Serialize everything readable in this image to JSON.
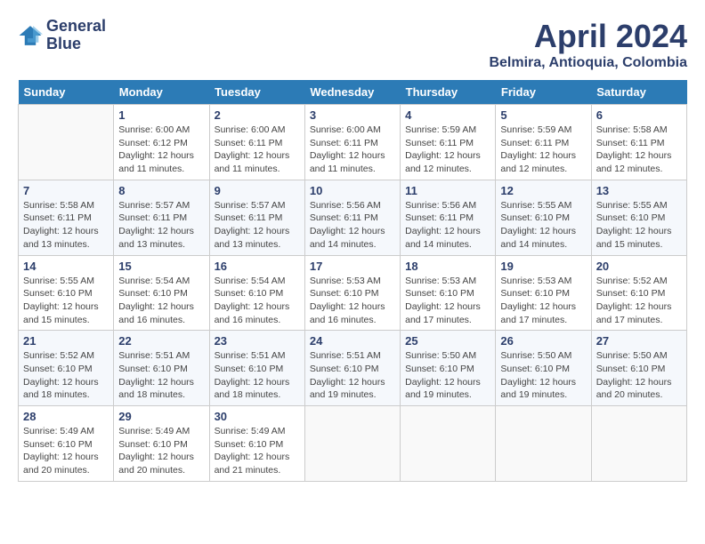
{
  "header": {
    "logo_line1": "General",
    "logo_line2": "Blue",
    "month": "April 2024",
    "location": "Belmira, Antioquia, Colombia"
  },
  "weekdays": [
    "Sunday",
    "Monday",
    "Tuesday",
    "Wednesday",
    "Thursday",
    "Friday",
    "Saturday"
  ],
  "weeks": [
    [
      {
        "day": "",
        "info": ""
      },
      {
        "day": "1",
        "info": "Sunrise: 6:00 AM\nSunset: 6:12 PM\nDaylight: 12 hours\nand 11 minutes."
      },
      {
        "day": "2",
        "info": "Sunrise: 6:00 AM\nSunset: 6:11 PM\nDaylight: 12 hours\nand 11 minutes."
      },
      {
        "day": "3",
        "info": "Sunrise: 6:00 AM\nSunset: 6:11 PM\nDaylight: 12 hours\nand 11 minutes."
      },
      {
        "day": "4",
        "info": "Sunrise: 5:59 AM\nSunset: 6:11 PM\nDaylight: 12 hours\nand 12 minutes."
      },
      {
        "day": "5",
        "info": "Sunrise: 5:59 AM\nSunset: 6:11 PM\nDaylight: 12 hours\nand 12 minutes."
      },
      {
        "day": "6",
        "info": "Sunrise: 5:58 AM\nSunset: 6:11 PM\nDaylight: 12 hours\nand 12 minutes."
      }
    ],
    [
      {
        "day": "7",
        "info": "Sunrise: 5:58 AM\nSunset: 6:11 PM\nDaylight: 12 hours\nand 13 minutes."
      },
      {
        "day": "8",
        "info": "Sunrise: 5:57 AM\nSunset: 6:11 PM\nDaylight: 12 hours\nand 13 minutes."
      },
      {
        "day": "9",
        "info": "Sunrise: 5:57 AM\nSunset: 6:11 PM\nDaylight: 12 hours\nand 13 minutes."
      },
      {
        "day": "10",
        "info": "Sunrise: 5:56 AM\nSunset: 6:11 PM\nDaylight: 12 hours\nand 14 minutes."
      },
      {
        "day": "11",
        "info": "Sunrise: 5:56 AM\nSunset: 6:11 PM\nDaylight: 12 hours\nand 14 minutes."
      },
      {
        "day": "12",
        "info": "Sunrise: 5:55 AM\nSunset: 6:10 PM\nDaylight: 12 hours\nand 14 minutes."
      },
      {
        "day": "13",
        "info": "Sunrise: 5:55 AM\nSunset: 6:10 PM\nDaylight: 12 hours\nand 15 minutes."
      }
    ],
    [
      {
        "day": "14",
        "info": "Sunrise: 5:55 AM\nSunset: 6:10 PM\nDaylight: 12 hours\nand 15 minutes."
      },
      {
        "day": "15",
        "info": "Sunrise: 5:54 AM\nSunset: 6:10 PM\nDaylight: 12 hours\nand 16 minutes."
      },
      {
        "day": "16",
        "info": "Sunrise: 5:54 AM\nSunset: 6:10 PM\nDaylight: 12 hours\nand 16 minutes."
      },
      {
        "day": "17",
        "info": "Sunrise: 5:53 AM\nSunset: 6:10 PM\nDaylight: 12 hours\nand 16 minutes."
      },
      {
        "day": "18",
        "info": "Sunrise: 5:53 AM\nSunset: 6:10 PM\nDaylight: 12 hours\nand 17 minutes."
      },
      {
        "day": "19",
        "info": "Sunrise: 5:53 AM\nSunset: 6:10 PM\nDaylight: 12 hours\nand 17 minutes."
      },
      {
        "day": "20",
        "info": "Sunrise: 5:52 AM\nSunset: 6:10 PM\nDaylight: 12 hours\nand 17 minutes."
      }
    ],
    [
      {
        "day": "21",
        "info": "Sunrise: 5:52 AM\nSunset: 6:10 PM\nDaylight: 12 hours\nand 18 minutes."
      },
      {
        "day": "22",
        "info": "Sunrise: 5:51 AM\nSunset: 6:10 PM\nDaylight: 12 hours\nand 18 minutes."
      },
      {
        "day": "23",
        "info": "Sunrise: 5:51 AM\nSunset: 6:10 PM\nDaylight: 12 hours\nand 18 minutes."
      },
      {
        "day": "24",
        "info": "Sunrise: 5:51 AM\nSunset: 6:10 PM\nDaylight: 12 hours\nand 19 minutes."
      },
      {
        "day": "25",
        "info": "Sunrise: 5:50 AM\nSunset: 6:10 PM\nDaylight: 12 hours\nand 19 minutes."
      },
      {
        "day": "26",
        "info": "Sunrise: 5:50 AM\nSunset: 6:10 PM\nDaylight: 12 hours\nand 19 minutes."
      },
      {
        "day": "27",
        "info": "Sunrise: 5:50 AM\nSunset: 6:10 PM\nDaylight: 12 hours\nand 20 minutes."
      }
    ],
    [
      {
        "day": "28",
        "info": "Sunrise: 5:49 AM\nSunset: 6:10 PM\nDaylight: 12 hours\nand 20 minutes."
      },
      {
        "day": "29",
        "info": "Sunrise: 5:49 AM\nSunset: 6:10 PM\nDaylight: 12 hours\nand 20 minutes."
      },
      {
        "day": "30",
        "info": "Sunrise: 5:49 AM\nSunset: 6:10 PM\nDaylight: 12 hours\nand 21 minutes."
      },
      {
        "day": "",
        "info": ""
      },
      {
        "day": "",
        "info": ""
      },
      {
        "day": "",
        "info": ""
      },
      {
        "day": "",
        "info": ""
      }
    ]
  ]
}
